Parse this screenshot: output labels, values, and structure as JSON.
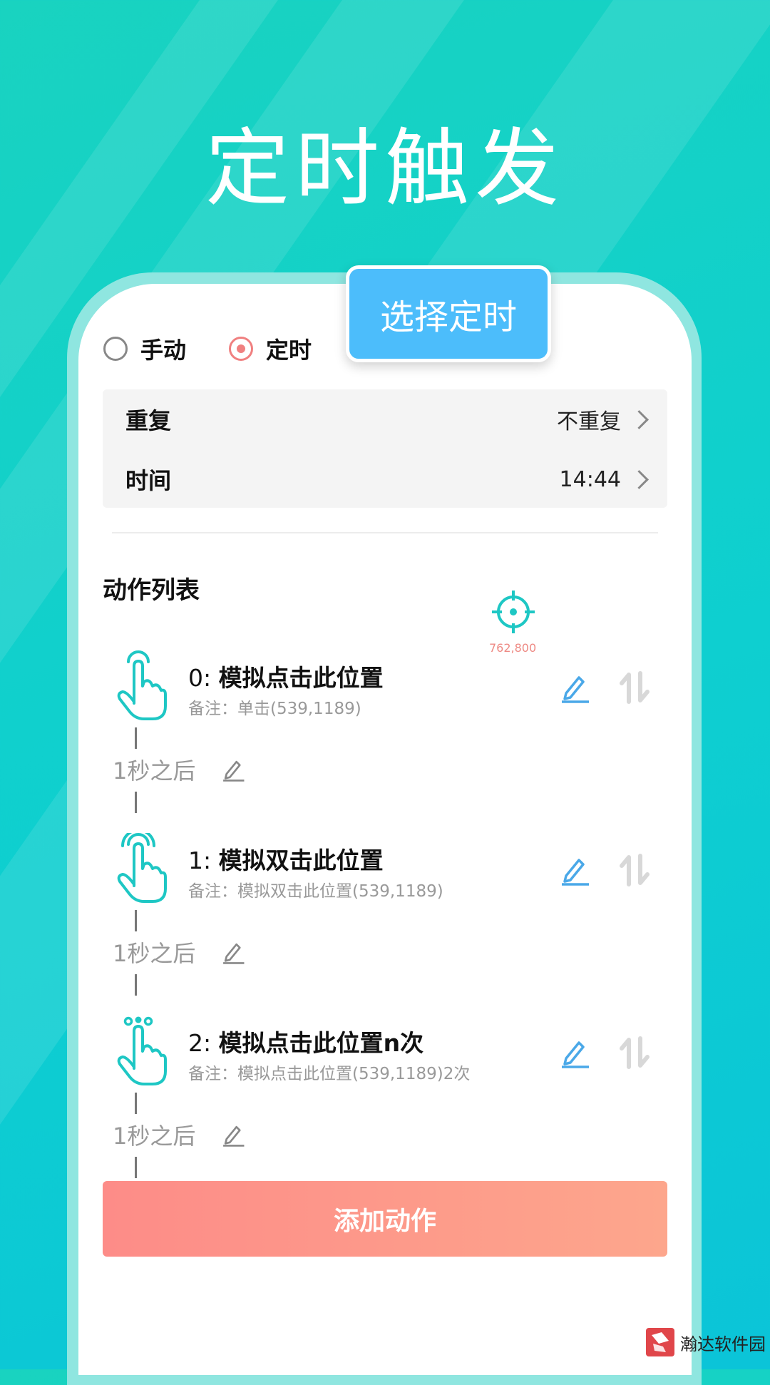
{
  "hero": {
    "title": "定时触发"
  },
  "popup": {
    "select_timer_label": "选择定时"
  },
  "trigger_mode": {
    "options": [
      {
        "label": "手动",
        "selected": false
      },
      {
        "label": "定时",
        "selected": true
      }
    ]
  },
  "settings": {
    "repeat": {
      "label": "重复",
      "value": "不重复"
    },
    "time": {
      "label": "时间",
      "value": "14:44"
    }
  },
  "actions": {
    "title": "动作列表",
    "target_coords": "762,800",
    "items": [
      {
        "index": "0: ",
        "name": "模拟点击此位置",
        "note": "备注：单击(539,1189)",
        "icon": "tap-hand-icon"
      },
      {
        "index": "1: ",
        "name": "模拟双击此位置",
        "note": "备注：模拟双击此位置(539,1189)",
        "icon": "double-tap-hand-icon"
      },
      {
        "index": "2: ",
        "name": "模拟点击此位置n次",
        "note": "备注：模拟点击此位置(539,1189)2次",
        "icon": "multi-tap-hand-icon"
      }
    ],
    "delays": [
      "1秒之后",
      "1秒之后",
      "1秒之后"
    ]
  },
  "add_action": {
    "label": "添加动作"
  },
  "watermark": {
    "text": "瀚达软件园"
  },
  "colors": {
    "accent_teal": "#1ecfc0",
    "popup_blue": "#4cbdfb",
    "edit_blue": "#4aa8e8",
    "radio_selected": "#f08080",
    "button_gradient_start": "#fd8c88",
    "button_gradient_end": "#fda68c"
  }
}
